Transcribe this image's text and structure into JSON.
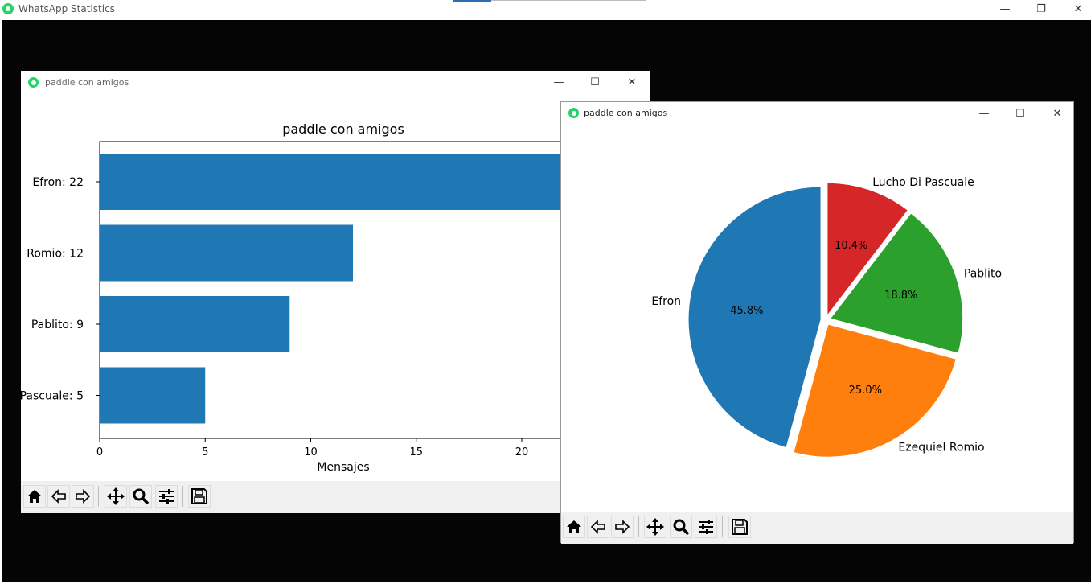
{
  "app": {
    "title": "WhatsApp Statistics"
  },
  "bar_window": {
    "title": "paddle  con amigos"
  },
  "pie_window": {
    "title": "paddle  con amigos"
  },
  "toolbar": {
    "buttons": [
      "home-icon",
      "back-icon",
      "forward-icon",
      "pan-icon",
      "zoom-icon",
      "configure-icon",
      "save-icon"
    ]
  },
  "chart_data": [
    {
      "type": "bar",
      "orientation": "horizontal",
      "title": "paddle  con amigos",
      "xlabel": "Mensajes",
      "ylabel": "",
      "categories": [
        "Efron:  22",
        "Romio:  12",
        "Pablito:  9",
        "Pascuale:  5"
      ],
      "values": [
        22,
        12,
        9,
        5
      ],
      "xticks": [
        "0",
        "5",
        "10",
        "15",
        "20"
      ],
      "xlim": [
        0,
        24
      ],
      "color": "#1f77b4"
    },
    {
      "type": "pie",
      "labels": [
        "Efron",
        "Ezequiel Romio",
        "Pablito",
        "Lucho Di Pascuale"
      ],
      "values": [
        45.8,
        25.0,
        18.8,
        10.4
      ],
      "percent_labels": [
        "45.8%",
        "25.0%",
        "18.8%",
        "10.4%"
      ],
      "colors": [
        "#1f77b4",
        "#ff7f0e",
        "#2ca02c",
        "#d62728"
      ],
      "exploded": true,
      "start_angle_deg": 90
    }
  ]
}
